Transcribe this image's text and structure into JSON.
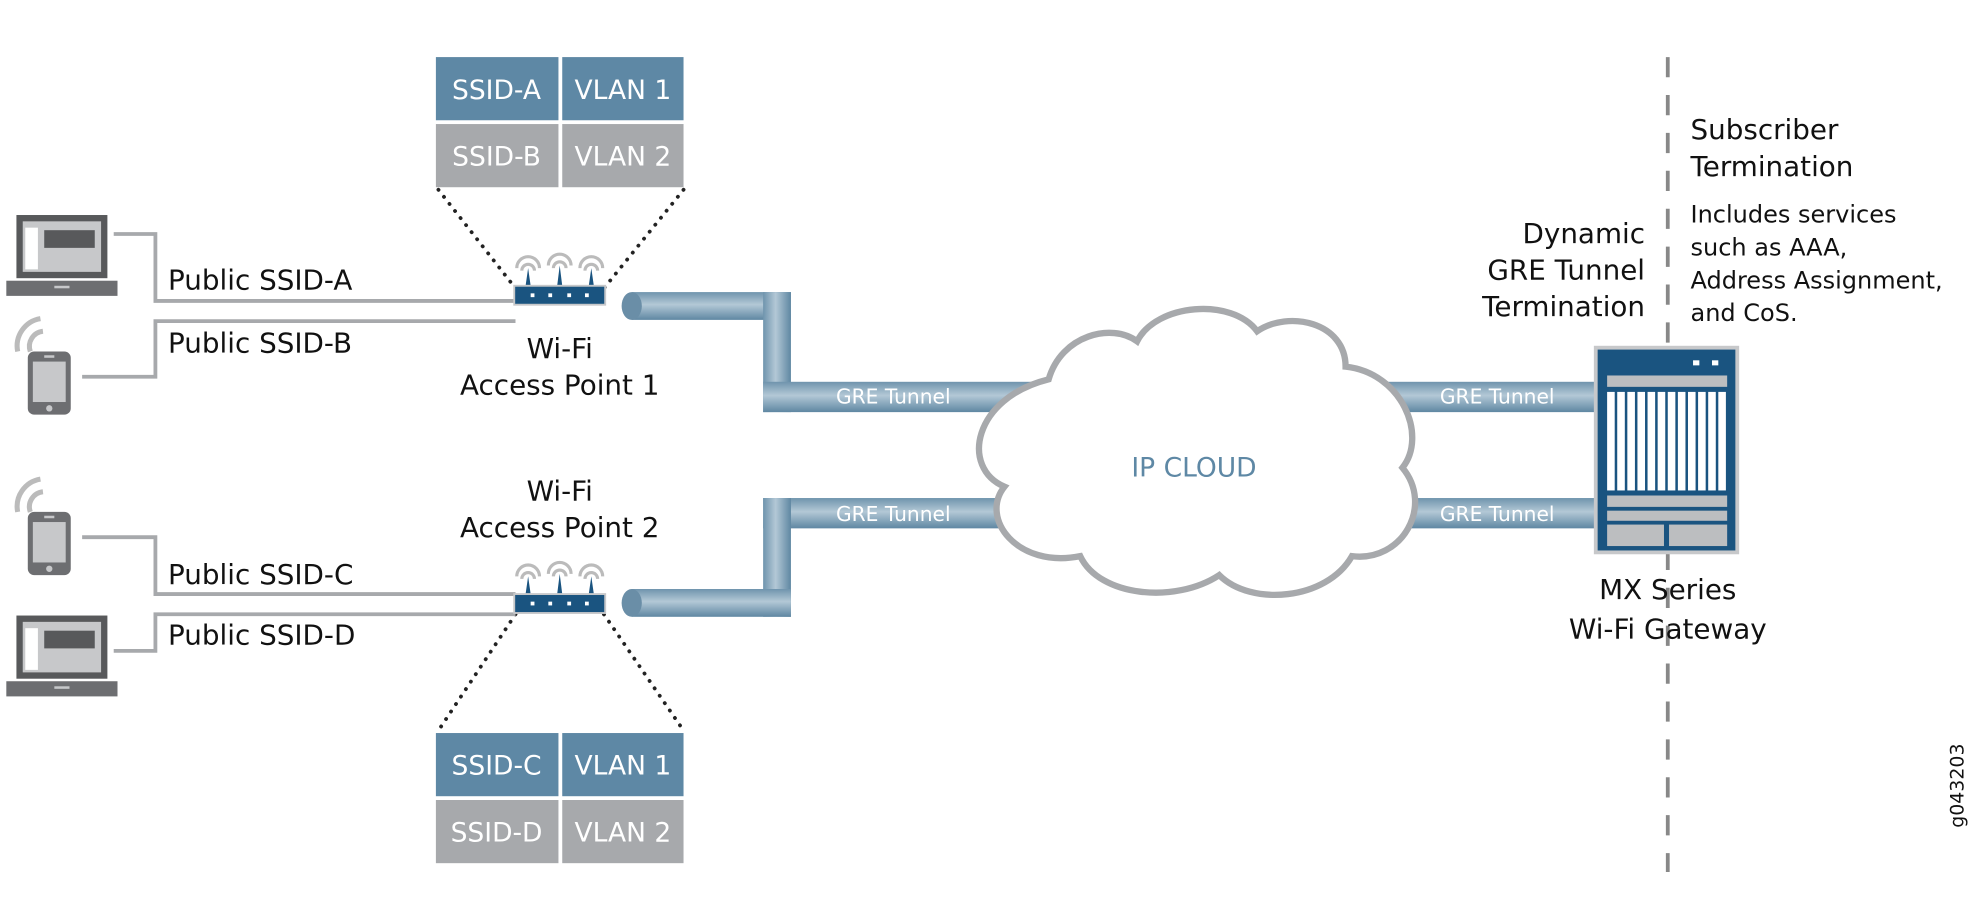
{
  "colors": {
    "blue_cell": "#5e88a5",
    "gray_cell": "#a7a9ac",
    "device_blue": "#1a5480",
    "tube": "#8fafc4",
    "cloud_stroke": "#a7a9ac",
    "cloud_text": "#5e88a5"
  },
  "top_table": [
    [
      "SSID-A",
      "VLAN 1"
    ],
    [
      "SSID-B",
      "VLAN 2"
    ]
  ],
  "bottom_table": [
    [
      "SSID-C",
      "VLAN 1"
    ],
    [
      "SSID-D",
      "VLAN 2"
    ]
  ],
  "links": {
    "a": "Public SSID-A",
    "b": "Public SSID-B",
    "c": "Public SSID-C",
    "d": "Public SSID-D"
  },
  "ap1": {
    "line1": "Wi-Fi",
    "line2": "Access Point 1"
  },
  "ap2": {
    "line1": "Wi-Fi",
    "line2": "Access Point 2"
  },
  "tunnel_label": "GRE Tunnel",
  "cloud_label": "IP CLOUD",
  "gre_termination": [
    "Dynamic",
    "GRE Tunnel",
    "Termination"
  ],
  "subscriber": {
    "title": [
      "Subscriber",
      "Termination"
    ],
    "desc": [
      "Includes services",
      "such as AAA,",
      "Address Assignment,",
      "and CoS."
    ]
  },
  "gateway": {
    "line1": "MX Series",
    "line2": "Wi-Fi Gateway"
  },
  "figure_id": "g043203"
}
